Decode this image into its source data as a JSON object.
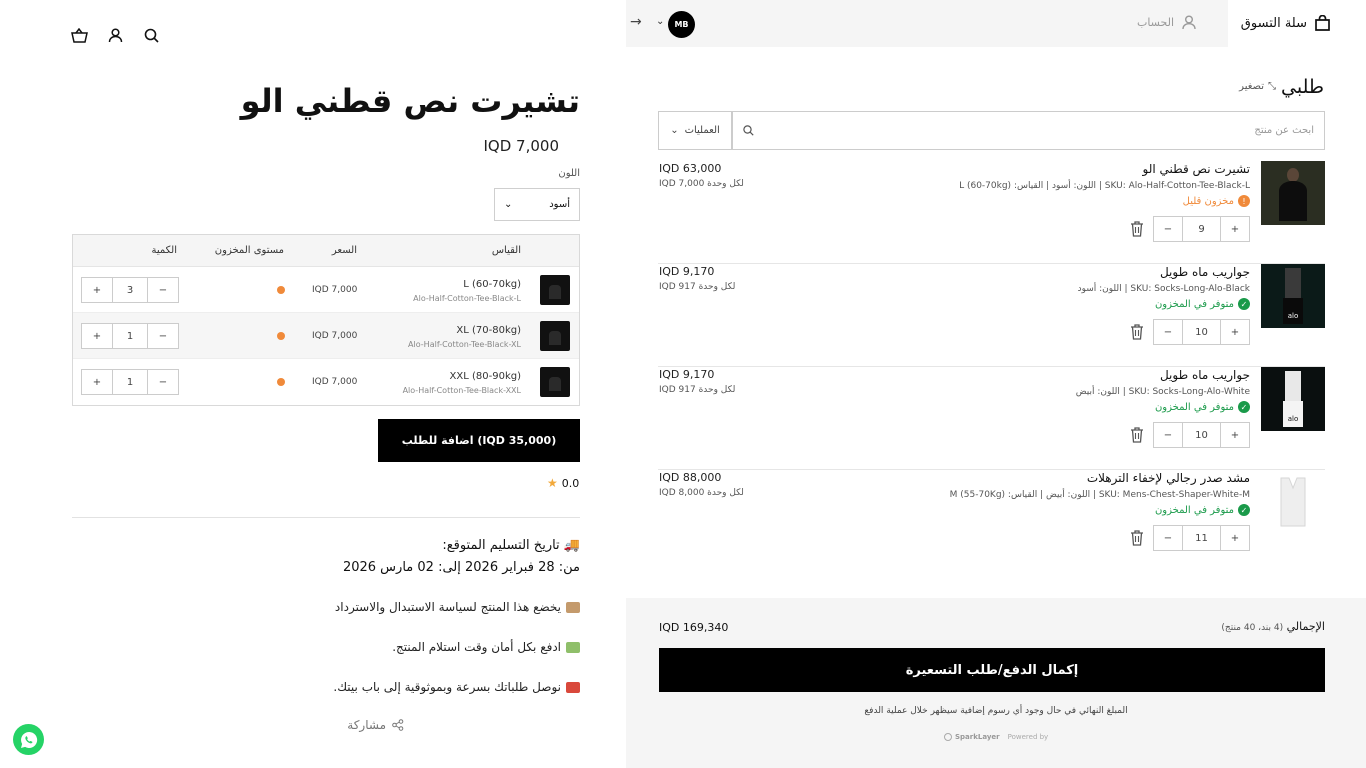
{
  "product": {
    "title": "تشيرت نص قطني الو",
    "price": "IQD 7,000",
    "color_label": "اللون",
    "color_value": "أسود",
    "table": {
      "headers": {
        "size": "القياس",
        "price": "السعر",
        "stock": "مستوى المخزون",
        "qty": "الكمية"
      },
      "rows": [
        {
          "size": "L (60-70kg)",
          "sku": "Alo-Half-Cotton-Tee-Black-L",
          "price": "IQD 7,000",
          "qty": "3"
        },
        {
          "size": "XL (70-80kg)",
          "sku": "Alo-Half-Cotton-Tee-Black-XL",
          "price": "IQD 7,000",
          "qty": "1"
        },
        {
          "size": "XXL (80-90kg)",
          "sku": "Alo-Half-Cotton-Tee-Black-XXL",
          "price": "IQD 7,000",
          "qty": "1"
        }
      ]
    },
    "add_button": "(IQD 35,000) اضافة للطلب",
    "rating": "0.0",
    "delivery_title": "تاريخ التسليم المتوقع:",
    "delivery_dates": "من: 28 فبراير 2026 إلى: 02 مارس 2026",
    "info": [
      "يخضع هذا المنتج لسياسة الاستبدال والاسترداد",
      "ادفع بكل أمان وقت استلام المنتج.",
      "نوصل طلباتك بسرعة وبموثوقية إلى باب بيتك."
    ],
    "share": "مشاركة"
  },
  "cart": {
    "title": "سلة التسوق",
    "account": "الحساب",
    "avatar": "MB",
    "order_title": "طلبي",
    "expand": "تصغير",
    "search_placeholder": "ابحث عن منتج",
    "operations": "العمليات",
    "items": [
      {
        "name": "تشيرت نص قطني الو",
        "sku": "SKU: Alo-Half-Cotton-Tee-Black-L | اللون: أسود | القياس: L (60-70kg)",
        "stock": "مخزون قليل",
        "stock_color": "#f08a3a",
        "qty": "9",
        "total": "IQD 63,000",
        "unit": "IQD 7,000 لكل وحدة"
      },
      {
        "name": "جواريب ماه طويل",
        "sku": "SKU: Socks-Long-Alo-Black | اللون: أسود",
        "stock": "متوفر في المخزون",
        "stock_color": "#1a9a4a",
        "qty": "10",
        "total": "IQD 9,170",
        "unit": "IQD 917 لكل وحدة"
      },
      {
        "name": "جواريب ماه طويل",
        "sku": "SKU: Socks-Long-Alo-White | اللون: أبيض",
        "stock": "متوفر في المخزون",
        "stock_color": "#1a9a4a",
        "qty": "10",
        "total": "IQD 9,170",
        "unit": "IQD 917 لكل وحدة"
      },
      {
        "name": "مشد صدر رجالي لإخفاء الترهلات",
        "sku": "SKU: Mens-Chest-Shaper-White-M | اللون: أبيض | القياس: M (55-70Kg)",
        "stock": "متوفر في المخزون",
        "stock_color": "#1a9a4a",
        "qty": "11",
        "total": "IQD 88,000",
        "unit": "IQD 8,000 لكل وحدة"
      }
    ],
    "total_label": "الإجمالي",
    "total_count": "(4 بند، 40 منتج)",
    "total_value": "IQD 169,340",
    "checkout": "إكمال الدفع/طلب التسعيرة",
    "note": "المبلغ النهائي في حال وجود أي رسوم إضافية سيظهر خلال عملية الدفع",
    "powered_brand": "SparkLayer",
    "powered_label": "Powered by"
  }
}
